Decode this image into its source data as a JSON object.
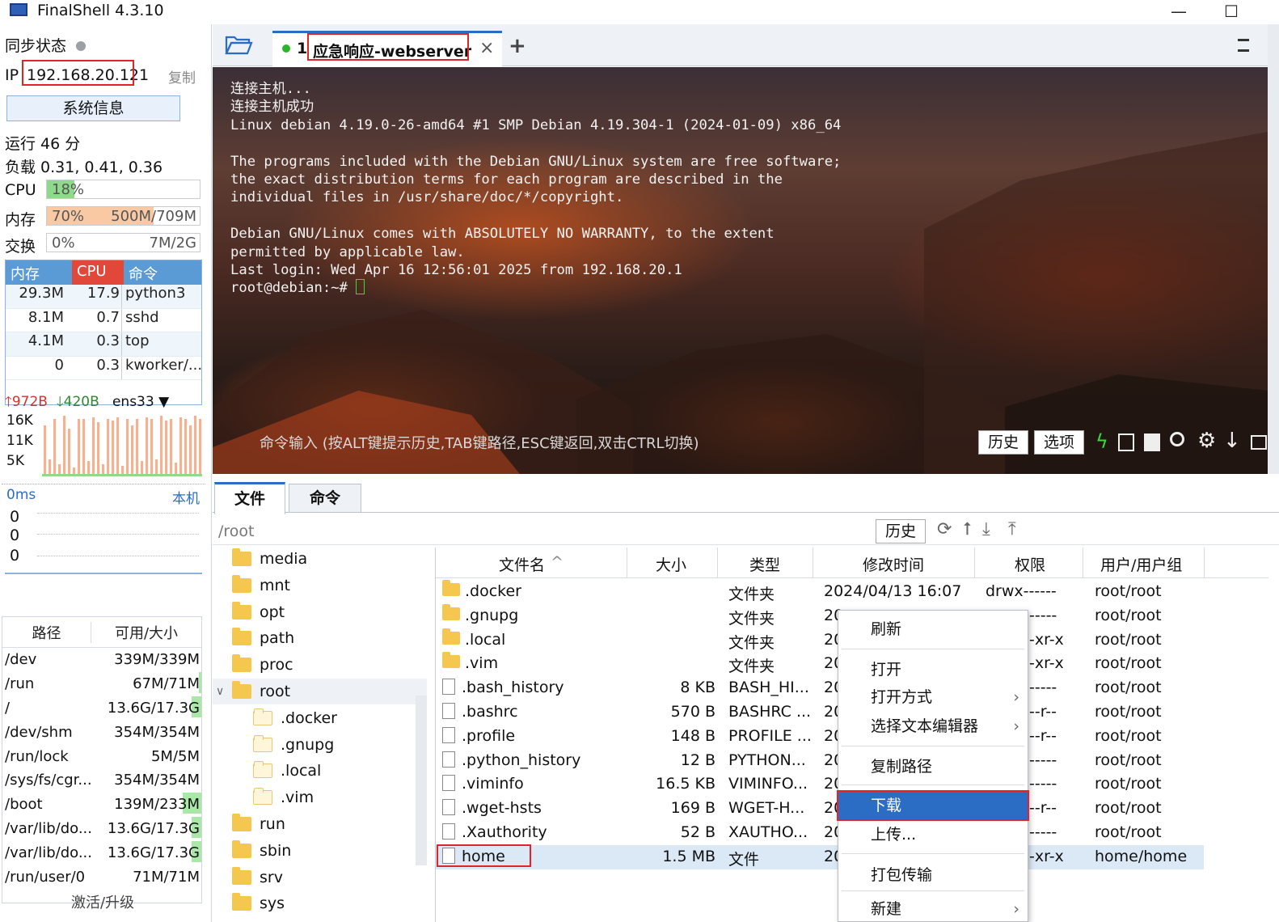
{
  "window": {
    "title": "FinalShell 4.3.10",
    "minimize_glyph": "—",
    "maximize_glyph": "☐"
  },
  "left": {
    "sync_label": "同步状态",
    "ip_label": "IP",
    "ip_value": "192.168.20.121",
    "copy_label": "复制",
    "sysinfo_button": "系统信息",
    "uptime": "运行 46 分",
    "load": "负载 0.31, 0.41, 0.36",
    "cpu": {
      "label": "CPU",
      "text": "18%",
      "percent": 18
    },
    "mem": {
      "label": "内存",
      "text": "70%",
      "value": "500M/709M",
      "percent": 70
    },
    "swap": {
      "label": "交换",
      "text": "0%",
      "value": "7M/2G",
      "percent": 0
    },
    "proc_headers": [
      "内存",
      "CPU",
      "命令"
    ],
    "processes": [
      {
        "mem": "29.3M",
        "cpu": "17.9",
        "cmd": "python3"
      },
      {
        "mem": "8.1M",
        "cpu": "0.7",
        "cmd": "sshd"
      },
      {
        "mem": "4.1M",
        "cpu": "0.3",
        "cmd": "top"
      },
      {
        "mem": "0",
        "cpu": "0.3",
        "cmd": "kworker/..."
      }
    ],
    "net": {
      "up": "972B",
      "down": "420B",
      "iface": "ens33",
      "y_ticks": [
        "16K",
        "11K",
        "5K"
      ]
    },
    "ping": {
      "label": "0ms",
      "host": "本机",
      "values": [
        "0",
        "0",
        "0"
      ]
    },
    "disk_headers": [
      "路径",
      "可用/大小"
    ],
    "disks": [
      {
        "path": "/dev",
        "size": "339M/339M",
        "usage": 0
      },
      {
        "path": "/run",
        "size": "67M/71M",
        "usage": 5
      },
      {
        "path": "/",
        "size": "13.6G/17.3G",
        "usage": 21
      },
      {
        "path": "/dev/shm",
        "size": "354M/354M",
        "usage": 0
      },
      {
        "path": "/run/lock",
        "size": "5M/5M",
        "usage": 0
      },
      {
        "path": "/sys/fs/cgr...",
        "size": "354M/354M",
        "usage": 0
      },
      {
        "path": "/boot",
        "size": "139M/233M",
        "usage": 40
      },
      {
        "path": "/var/lib/do...",
        "size": "13.6G/17.3G",
        "usage": 21
      },
      {
        "path": "/var/lib/do...",
        "size": "13.6G/17.3G",
        "usage": 21
      },
      {
        "path": "/run/user/0",
        "size": "71M/71M",
        "usage": 0
      }
    ],
    "activate": "激活/升级"
  },
  "tabs": {
    "session_num": "1",
    "session_name": "应急响应-webserver",
    "close_glyph": "×",
    "add_glyph": "+"
  },
  "terminal": {
    "lines": [
      "连接主机...",
      "连接主机成功",
      "Linux debian 4.19.0-26-amd64 #1 SMP Debian 4.19.304-1 (2024-01-09) x86_64",
      "",
      "The programs included with the Debian GNU/Linux system are free software;",
      "the exact distribution terms for each program are described in the",
      "individual files in /usr/share/doc/*/copyright.",
      "",
      "Debian GNU/Linux comes with ABSOLUTELY NO WARRANTY, to the extent",
      "permitted by applicable law.",
      "Last login: Wed Apr 16 12:56:01 2025 from 192.168.20.1"
    ],
    "prompt": "root@debian:~# ",
    "cmd_hint": "命令输入 (按ALT键提示历史,TAB键路径,ESC键返回,双击CTRL切换)",
    "history_btn": "历史",
    "options_btn": "选项"
  },
  "files": {
    "tab_files": "文件",
    "tab_cmd": "命令",
    "path": "/root",
    "history_btn": "历史",
    "tree": [
      {
        "name": "media",
        "level": 0
      },
      {
        "name": "mnt",
        "level": 0
      },
      {
        "name": "opt",
        "level": 0
      },
      {
        "name": "path",
        "level": 0
      },
      {
        "name": "proc",
        "level": 0
      },
      {
        "name": "root",
        "level": 0,
        "expanded": true
      },
      {
        "name": ".docker",
        "level": 1
      },
      {
        "name": ".gnupg",
        "level": 1
      },
      {
        "name": ".local",
        "level": 1
      },
      {
        "name": ".vim",
        "level": 1
      },
      {
        "name": "run",
        "level": 0
      },
      {
        "name": "sbin",
        "level": 0
      },
      {
        "name": "srv",
        "level": 0
      },
      {
        "name": "sys",
        "level": 0
      }
    ],
    "columns": [
      "文件名",
      "大小",
      "类型",
      "修改时间",
      "权限",
      "用户/用户组"
    ],
    "rows": [
      {
        "name": ".docker",
        "size": "",
        "type": "文件夹",
        "mtime": "2024/04/13 16:07",
        "perm": "drwx------",
        "owner": "root/root",
        "folder": true
      },
      {
        "name": ".gnupg",
        "size": "",
        "type": "文件夹",
        "mtime": "20",
        "perm": "-----",
        "owner": "root/root",
        "folder": true
      },
      {
        "name": ".local",
        "size": "",
        "type": "文件夹",
        "mtime": "20",
        "perm": "-xr-x",
        "owner": "root/root",
        "folder": true
      },
      {
        "name": ".vim",
        "size": "",
        "type": "文件夹",
        "mtime": "20",
        "perm": "-xr-x",
        "owner": "root/root",
        "folder": true
      },
      {
        "name": ".bash_history",
        "size": "8 KB",
        "type": "BASH_HI...",
        "mtime": "20",
        "perm": "-----",
        "owner": "root/root",
        "folder": false
      },
      {
        "name": ".bashrc",
        "size": "570 B",
        "type": "BASHRC ...",
        "mtime": "20",
        "perm": "--r--",
        "owner": "root/root",
        "folder": false
      },
      {
        "name": ".profile",
        "size": "148 B",
        "type": "PROFILE ...",
        "mtime": "20",
        "perm": "--r--",
        "owner": "root/root",
        "folder": false
      },
      {
        "name": ".python_history",
        "size": "12 B",
        "type": "PYTHON...",
        "mtime": "20",
        "perm": "-----",
        "owner": "root/root",
        "folder": false
      },
      {
        "name": ".viminfo",
        "size": "16.5 KB",
        "type": "VIMINFO...",
        "mtime": "20",
        "perm": "-----",
        "owner": "root/root",
        "folder": false
      },
      {
        "name": ".wget-hsts",
        "size": "169 B",
        "type": "WGET-H...",
        "mtime": "20",
        "perm": "--r--",
        "owner": "root/root",
        "folder": false
      },
      {
        "name": ".Xauthority",
        "size": "52 B",
        "type": "XAUTHO...",
        "mtime": "20",
        "perm": "-----",
        "owner": "root/root",
        "folder": false
      },
      {
        "name": "home",
        "size": "1.5 MB",
        "type": "文件",
        "mtime": "20",
        "perm": "-xr-x",
        "owner": "home/home",
        "folder": false
      }
    ],
    "menu": [
      "刷新",
      "打开",
      "打开方式",
      "选择文本编辑器",
      "复制路径",
      "下载",
      "上传...",
      "打包传输",
      "新建"
    ]
  },
  "colors": {
    "accent": "#2b6cc4",
    "highlight_red": "#e0242a",
    "cpu_fill": "#8fd98c",
    "mem_fill": "#f9c9a4",
    "header_blue": "#5b9bd5"
  }
}
